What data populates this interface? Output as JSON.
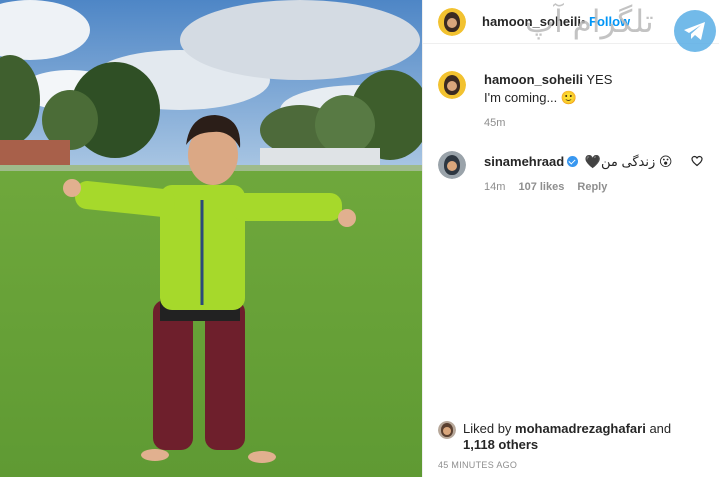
{
  "post": {
    "username": "hamoon_soheili",
    "separator": "•",
    "follow_label": "Follow"
  },
  "watermark": {
    "text": "تلگرام آپ",
    "logo_icon": "telegram-icon"
  },
  "comments": [
    {
      "username": "hamoon_soheili",
      "text_line1": "YES",
      "text_line2": "I'm coming... 🙂",
      "age": "45m"
    },
    {
      "username": "sinamehraad",
      "verified": true,
      "text": "🖤زندگی من 😮",
      "age": "14m",
      "likes": "107 likes",
      "reply_label": "Reply"
    }
  ],
  "liked_by": {
    "prefix": "Liked by",
    "user": "mohamadrezaghafari",
    "conjunction": "and",
    "others": "1,118 others"
  },
  "timestamp": "45 MINUTES AGO",
  "colors": {
    "accent": "#0095f6",
    "verified": "#3897f0",
    "muted": "#8e8e8e"
  }
}
